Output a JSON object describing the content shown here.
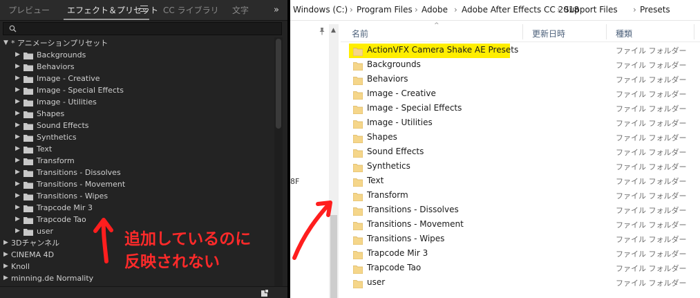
{
  "ae_panel": {
    "tabs": [
      {
        "label": "プレビュー",
        "active": false
      },
      {
        "label": "エフェクト＆プリセット",
        "active": true
      },
      {
        "label": "CC ライブラリ",
        "active": false
      },
      {
        "label": "文字",
        "active": false
      }
    ],
    "more_label": "»",
    "search": {
      "placeholder": ""
    },
    "tree": [
      {
        "label": "* アニメーションプリセット",
        "level": 0,
        "expanded": true,
        "folder": false
      },
      {
        "label": "Backgrounds",
        "level": 1,
        "expanded": false,
        "folder": true
      },
      {
        "label": "Behaviors",
        "level": 1,
        "expanded": false,
        "folder": true
      },
      {
        "label": "Image - Creative",
        "level": 1,
        "expanded": false,
        "folder": true
      },
      {
        "label": "Image - Special Effects",
        "level": 1,
        "expanded": false,
        "folder": true
      },
      {
        "label": "Image - Utilities",
        "level": 1,
        "expanded": false,
        "folder": true
      },
      {
        "label": "Shapes",
        "level": 1,
        "expanded": false,
        "folder": true
      },
      {
        "label": "Sound Effects",
        "level": 1,
        "expanded": false,
        "folder": true
      },
      {
        "label": "Synthetics",
        "level": 1,
        "expanded": false,
        "folder": true
      },
      {
        "label": "Text",
        "level": 1,
        "expanded": false,
        "folder": true
      },
      {
        "label": "Transform",
        "level": 1,
        "expanded": false,
        "folder": true
      },
      {
        "label": "Transitions - Dissolves",
        "level": 1,
        "expanded": false,
        "folder": true
      },
      {
        "label": "Transitions - Movement",
        "level": 1,
        "expanded": false,
        "folder": true
      },
      {
        "label": "Transitions - Wipes",
        "level": 1,
        "expanded": false,
        "folder": true
      },
      {
        "label": "Trapcode Mir 3",
        "level": 1,
        "expanded": false,
        "folder": true
      },
      {
        "label": "Trapcode Tao",
        "level": 1,
        "expanded": false,
        "folder": true
      },
      {
        "label": "user",
        "level": 1,
        "expanded": false,
        "folder": true
      },
      {
        "label": "3Dチャンネル",
        "level": 0,
        "expanded": false,
        "folder": false
      },
      {
        "label": "CINEMA 4D",
        "level": 0,
        "expanded": false,
        "folder": false
      },
      {
        "label": "Knoll",
        "level": 0,
        "expanded": false,
        "folder": false
      },
      {
        "label": "minning.de Normality",
        "level": 0,
        "expanded": false,
        "folder": false
      }
    ],
    "annotation": {
      "line1": "追加しているのに",
      "line2": "反映されない",
      "color": "#ff2a2a"
    }
  },
  "explorer": {
    "breadcrumb": [
      "Windows (C:)",
      "Program Files",
      "Adobe",
      "Adobe After Effects CC 2018",
      "Support Files",
      "Presets"
    ],
    "breadcrumb_separator": "›",
    "nav_fragment": "8F",
    "columns": {
      "name": "名前",
      "modified": "更新日時",
      "type": "種類"
    },
    "files": [
      {
        "name": "ActionVFX Camera Shake AE Presets",
        "type": "ファイル フォルダー",
        "highlight": true
      },
      {
        "name": "Backgrounds",
        "type": "ファイル フォルダー",
        "highlight": false
      },
      {
        "name": "Behaviors",
        "type": "ファイル フォルダー",
        "highlight": false
      },
      {
        "name": "Image - Creative",
        "type": "ファイル フォルダー",
        "highlight": false
      },
      {
        "name": "Image - Special Effects",
        "type": "ファイル フォルダー",
        "highlight": false
      },
      {
        "name": "Image - Utilities",
        "type": "ファイル フォルダー",
        "highlight": false
      },
      {
        "name": "Shapes",
        "type": "ファイル フォルダー",
        "highlight": false
      },
      {
        "name": "Sound Effects",
        "type": "ファイル フォルダー",
        "highlight": false
      },
      {
        "name": "Synthetics",
        "type": "ファイル フォルダー",
        "highlight": false
      },
      {
        "name": "Text",
        "type": "ファイル フォルダー",
        "highlight": false
      },
      {
        "name": "Transform",
        "type": "ファイル フォルダー",
        "highlight": false
      },
      {
        "name": "Transitions - Dissolves",
        "type": "ファイル フォルダー",
        "highlight": false
      },
      {
        "name": "Transitions - Movement",
        "type": "ファイル フォルダー",
        "highlight": false
      },
      {
        "name": "Transitions - Wipes",
        "type": "ファイル フォルダー",
        "highlight": false
      },
      {
        "name": "Trapcode Mir 3",
        "type": "ファイル フォルダー",
        "highlight": false
      },
      {
        "name": "Trapcode Tao",
        "type": "ファイル フォルダー",
        "highlight": false
      },
      {
        "name": "user",
        "type": "ファイル フォルダー",
        "highlight": false
      }
    ],
    "highlight_color": "#ffee00",
    "folder_color": "#f5d68a"
  }
}
